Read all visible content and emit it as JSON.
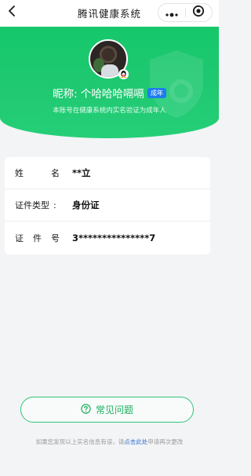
{
  "navbar": {
    "title": "腾讯健康系统"
  },
  "header": {
    "nickname": "昵称: 个哈哈哈嗝嗝",
    "adult_badge": "成年",
    "verify_note": "本账号在健康系统内实名验证为成年人"
  },
  "info": {
    "rows": [
      {
        "label_a": "姓",
        "label_b": "名",
        "colon": ":",
        "value": "**立"
      },
      {
        "label_a": "证件类型",
        "label_b": "",
        "colon": ":",
        "value": "身份证"
      },
      {
        "label_a": "证",
        "label_mid": "件",
        "label_b": "号",
        "colon": ":",
        "value": "3***************7"
      }
    ]
  },
  "faq": {
    "label": "常见问题"
  },
  "footer": {
    "prefix": "如果您发现以上实名信息有误，请",
    "link": "点击此处",
    "suffix": "申请再次更改"
  },
  "colors": {
    "brand_green": "#20c972",
    "badge_blue": "#1e7cf0",
    "link_blue": "#2f6fd3"
  },
  "icons": [
    "back-arrow-icon",
    "more-dots-icon",
    "target-close-icon",
    "shield-watermark-icon",
    "qq-penguin-icon",
    "question-circle-icon"
  ]
}
